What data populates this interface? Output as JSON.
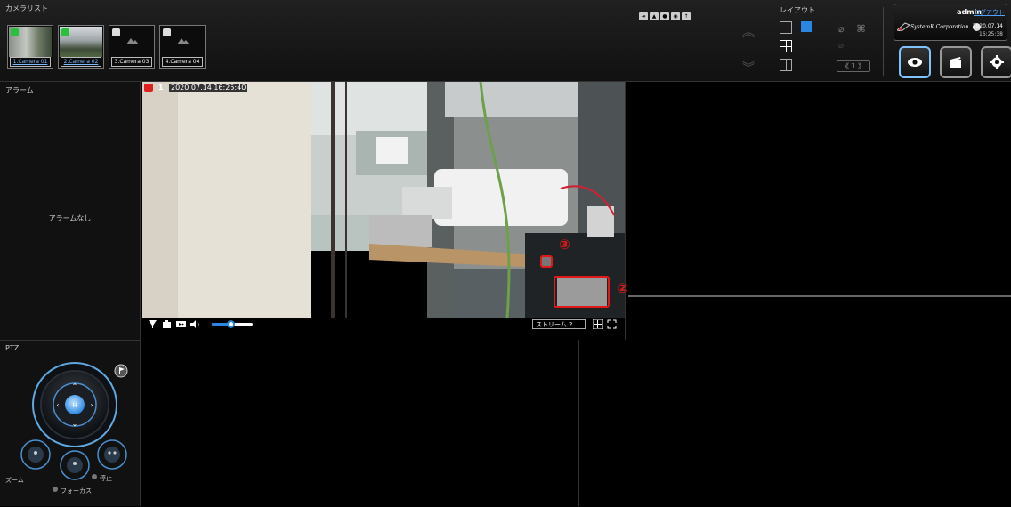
{
  "top": {
    "camera_list_title": "カメラリスト",
    "cameras": [
      {
        "label": "1.Camera 01",
        "state": "on",
        "placeholder": false
      },
      {
        "label": "2.Camera 02",
        "state": "on",
        "placeholder": false
      },
      {
        "label": "3.Camera 03",
        "state": "off",
        "placeholder": true
      },
      {
        "label": "4.Camera 04",
        "state": "off",
        "placeholder": true
      }
    ],
    "layout_title": "レイアウト",
    "page_indicator": "《 1 》",
    "user": {
      "name": "admin",
      "logout": "ログアウト",
      "company": "SystemK Corporation",
      "date": "2020.07.14",
      "time": "16:25:38"
    }
  },
  "left": {
    "alarm_title": "アラーム",
    "no_alarm": "アラームなし",
    "ptz_title": "PTZ",
    "zoom_label": "ズーム",
    "focus_label": "フォーカス",
    "stop_label": "停止"
  },
  "video": {
    "channel": "1",
    "timestamp": "2020.07.14 16:25:40",
    "stream": "ストリーム 2",
    "volume_fraction": 0.45
  },
  "annotations": {
    "marker_2": "②",
    "marker_3": "③"
  },
  "colors": {
    "accent_blue": "#2a86e0",
    "highlight_red": "#e01818",
    "status_green": "#29c040"
  }
}
